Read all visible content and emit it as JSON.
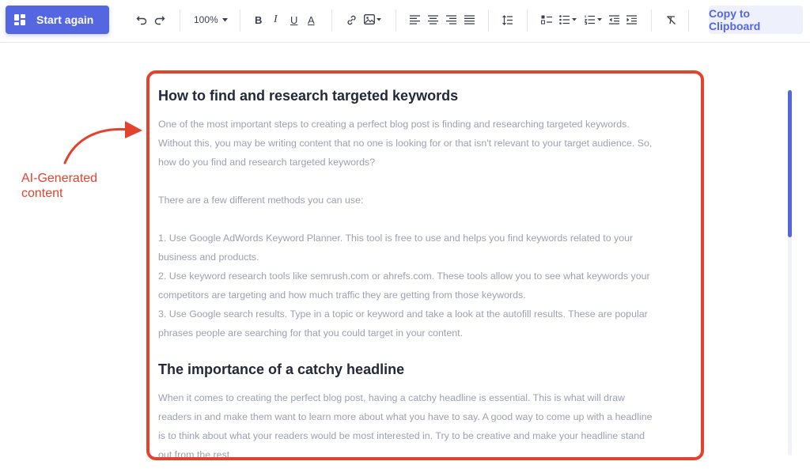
{
  "toolbar": {
    "start_label": "Start again",
    "zoom": "100%",
    "bold": "B",
    "italic": "I",
    "underline": "U",
    "color": "A",
    "copy_label": "Copy to Clipboard"
  },
  "annotation": {
    "line1": "AI-Generated",
    "line2": "content"
  },
  "content": {
    "heading1": "How to find and research targeted keywords",
    "para1": [
      "One of the most important steps to creating a perfect blog post is finding and researching targeted keywords.",
      "Without this, you may be writing content that no one is looking for or that isn't relevant to your target audience. So,",
      "how do you find and research targeted keywords?",
      "",
      "There are a few different methods you can use:",
      "",
      "1. Use Google AdWords Keyword Planner. This tool is free to use and helps you find keywords related to your",
      "business and products.",
      "2. Use keyword research tools like semrush.com or ahrefs.com. These tools allow you to see what keywords your",
      "competitors are targeting and how much traffic they are getting from those keywords.",
      "3. Use Google search results. Type in a topic or keyword and take a look at the autofill results. These are popular",
      "phrases people are searching for that you could target in your content."
    ],
    "heading2": "The importance of a catchy headline",
    "para2": [
      "When it comes to creating the perfect blog post, having a catchy headline is essential. This is what will draw",
      "readers in and make them want to learn more about what you have to say. A good way to come up with a headline",
      "is to think about what your readers would be most interested in. Try to be creative and make your headline stand",
      "out from the rest."
    ]
  },
  "colors": {
    "accent": "#5466e0",
    "annotation": "#e2432e",
    "heading": "#23283a",
    "body_text": "#9b9fb2"
  },
  "icons": [
    "grid-icon",
    "undo-icon",
    "redo-icon",
    "chevron-down-icon",
    "link-icon",
    "image-icon",
    "align-left-icon",
    "align-center-icon",
    "align-right-icon",
    "align-justify-icon",
    "line-spacing-icon",
    "checklist-icon",
    "bullet-list-icon",
    "numbered-list-icon",
    "outdent-icon",
    "indent-icon",
    "clear-format-icon"
  ]
}
